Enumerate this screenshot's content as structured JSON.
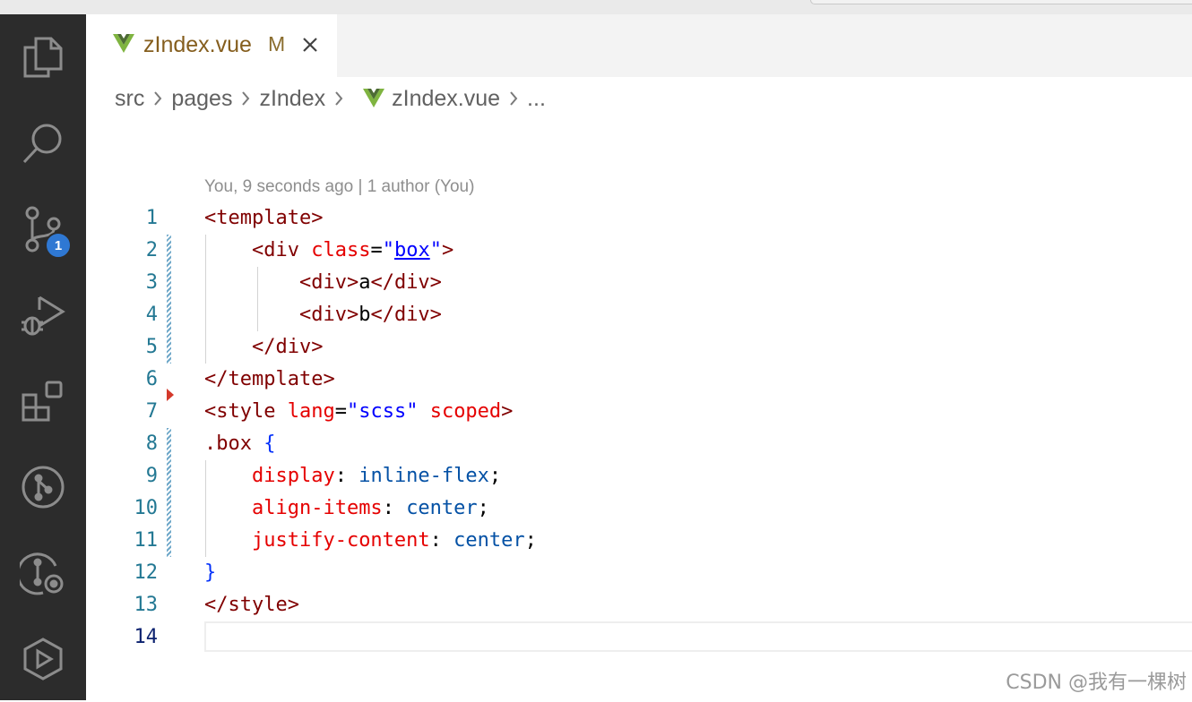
{
  "tab": {
    "label": "zIndex.vue",
    "modified": "M",
    "icon": "vue-icon",
    "close_icon": "close-icon"
  },
  "breadcrumb": {
    "items": [
      "src",
      "pages",
      "zIndex",
      "zIndex.vue",
      "..."
    ]
  },
  "activity_bar": {
    "items": [
      "explorer-icon",
      "search-icon",
      "source-control-icon",
      "run-debug-icon",
      "extensions-icon",
      "git-graph-icon",
      "gitlens-icon",
      "remote-icon"
    ],
    "source_control_badge": "1"
  },
  "editor": {
    "blame": "You, 9 seconds ago | 1 author (You)",
    "line_numbers": [
      "1",
      "2",
      "3",
      "4",
      "5",
      "6",
      "7",
      "8",
      "9",
      "10",
      "11",
      "12",
      "13",
      "14"
    ],
    "code": {
      "l1_open": "<template>",
      "l2_indent": "    ",
      "l2_tag_open": "<div",
      "l2_attr": " class",
      "l2_eq": "=",
      "l2_q1": "\"",
      "l2_val": "box",
      "l2_q2": "\"",
      "l2_close": ">",
      "l3_indent": "        ",
      "l3_open": "<div>",
      "l3_text": "a",
      "l3_close": "</div>",
      "l4_indent": "        ",
      "l4_open": "<div>",
      "l4_text": "b",
      "l4_close": "</div>",
      "l5_indent": "    ",
      "l5_close": "</div>",
      "l6_close": "</template>",
      "l7_open": "<style",
      "l7_attr1": " lang",
      "l7_eq": "=",
      "l7_val": "\"scss\"",
      "l7_attr2": " scoped",
      "l7_end": ">",
      "l8_sel": ".box",
      "l8_brace": " {",
      "l9_indent": "    ",
      "l9_prop": "display",
      "l9_colon": ": ",
      "l9_val": "inline-flex",
      "l9_semi": ";",
      "l10_indent": "    ",
      "l10_prop": "align-items",
      "l10_colon": ": ",
      "l10_val": "center",
      "l10_semi": ";",
      "l11_indent": "    ",
      "l11_prop": "justify-content",
      "l11_colon": ": ",
      "l11_val": "center",
      "l11_semi": ";",
      "l12_brace": "}",
      "l13_close": "</style>",
      "l14": ""
    },
    "current_line": "14"
  },
  "watermark": "CSDN @我有一棵树",
  "colors": {
    "activity_bg": "#2c2c2c",
    "badge": "#2f78d3",
    "tag": "#800000",
    "attr": "#e50000",
    "string": "#0000ff",
    "value": "#0451a5",
    "line_number": "#237893"
  }
}
